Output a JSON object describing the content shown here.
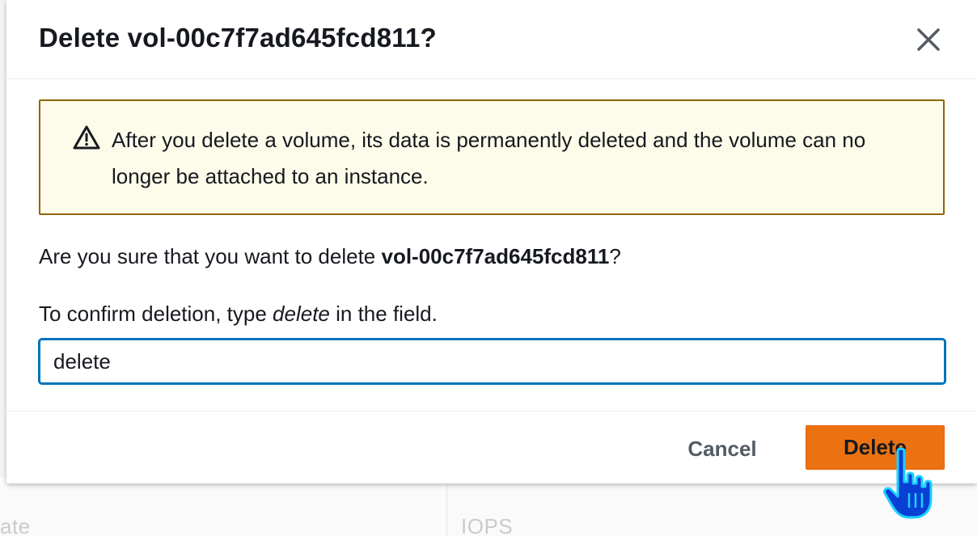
{
  "background": {
    "left_text": "ate",
    "right_text": "IOPS"
  },
  "modal": {
    "title": "Delete vol-00c7f7ad645fcd811?",
    "close_icon": "close-icon",
    "alert": {
      "icon": "warning-icon",
      "text": "After you delete a volume, its data is permanently deleted and the volume can no longer be attached to an instance."
    },
    "question_prefix": "Are you sure that you want to delete ",
    "question_volume": "vol-00c7f7ad645fcd811",
    "question_suffix": "?",
    "instruction_prefix": "To confirm deletion, type ",
    "instruction_keyword": "delete",
    "instruction_suffix": " in the field.",
    "input": {
      "value": "delete",
      "placeholder": ""
    },
    "footer": {
      "cancel_label": "Cancel",
      "delete_label": "Delete"
    }
  },
  "colors": {
    "primary_button": "#ec7211",
    "alert_background": "#fdfbe9",
    "alert_border": "#8d6605",
    "input_focus": "#0073bb"
  }
}
